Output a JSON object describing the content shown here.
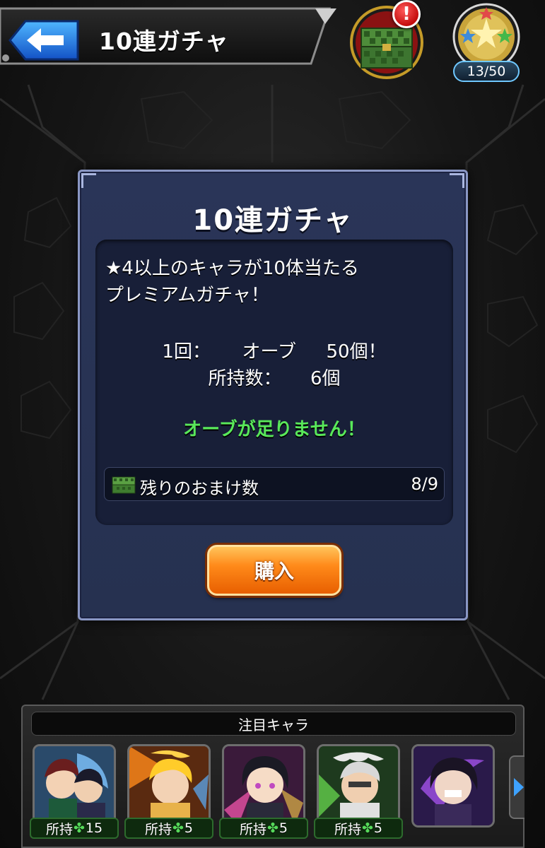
{
  "header": {
    "title": "10連ガチャ",
    "alert_mark": "!",
    "stamina_count": "13/50"
  },
  "dialog": {
    "title": "10連ガチャ",
    "description_line1": "★4以上のキャラが10体当たる",
    "description_line2": "プレミアムガチャ！",
    "cost_label": "1回：",
    "cost_currency": "オーブ",
    "cost_amount": "50個！",
    "owned_label": "所持数：",
    "owned_amount": "6個",
    "warning": "オーブが足りません！",
    "bonus_label": "残りのおまけ数",
    "bonus_value": "8/9",
    "buy_label": "購入"
  },
  "featured": {
    "title": "注目キャラ",
    "owned_prefix": "所持",
    "clover_glyph": "✤",
    "characters": [
      {
        "name_icon": "character-1-portrait",
        "owned_count": "15"
      },
      {
        "name_icon": "character-2-portrait",
        "owned_count": "5"
      },
      {
        "name_icon": "character-3-portrait",
        "owned_count": "5"
      },
      {
        "name_icon": "character-4-portrait",
        "owned_count": "5"
      },
      {
        "name_icon": "character-5-portrait",
        "owned_count": ""
      }
    ]
  },
  "colors": {
    "warning_text": "#59e85a",
    "buy_button": "#ff8a1a",
    "dialog_bg": "#2a3558",
    "clover": "#56d95a"
  }
}
